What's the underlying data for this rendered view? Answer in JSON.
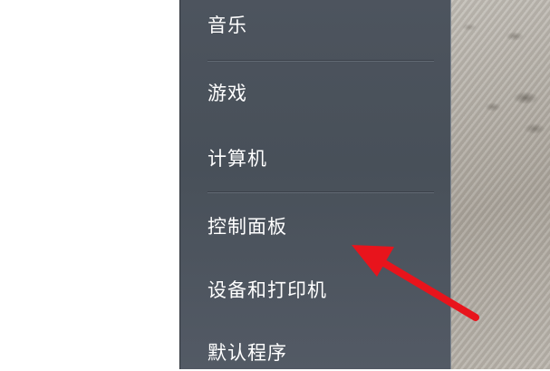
{
  "start_menu": {
    "items": [
      {
        "label": "音乐"
      },
      {
        "label": "游戏"
      },
      {
        "label": "计算机"
      },
      {
        "label": "控制面板"
      },
      {
        "label": "设备和打印机"
      },
      {
        "label": "默认程序"
      }
    ]
  },
  "annotation": {
    "arrow_color": "#e8141c",
    "points_to": "控制面板"
  },
  "colors": {
    "menu_background": "#4b525c",
    "menu_text": "#ffffff"
  }
}
